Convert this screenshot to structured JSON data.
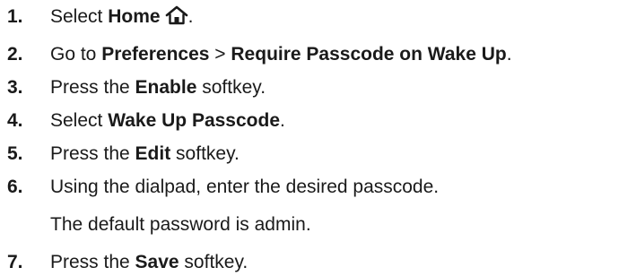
{
  "steps": [
    {
      "number": "1.",
      "prefix": "Select ",
      "bold1": "Home",
      "icon": "home-icon",
      "suffix": "."
    },
    {
      "number": "2.",
      "prefix": "Go to ",
      "bold1": "Preferences",
      "middle": " > ",
      "bold2": "Require Passcode on Wake Up",
      "suffix": "."
    },
    {
      "number": "3.",
      "prefix": "Press the ",
      "bold1": "Enable",
      "suffix": " softkey."
    },
    {
      "number": "4.",
      "prefix": "Select ",
      "bold1": "Wake Up Passcode",
      "suffix": "."
    },
    {
      "number": "5.",
      "prefix": "Press the ",
      "bold1": "Edit",
      "suffix": " softkey."
    },
    {
      "number": "6.",
      "text": "Using the dialpad, enter the desired passcode."
    },
    {
      "number": "7.",
      "prefix": "Press the ",
      "bold1": "Save",
      "suffix": " softkey."
    }
  ],
  "note": "The default password is admin."
}
